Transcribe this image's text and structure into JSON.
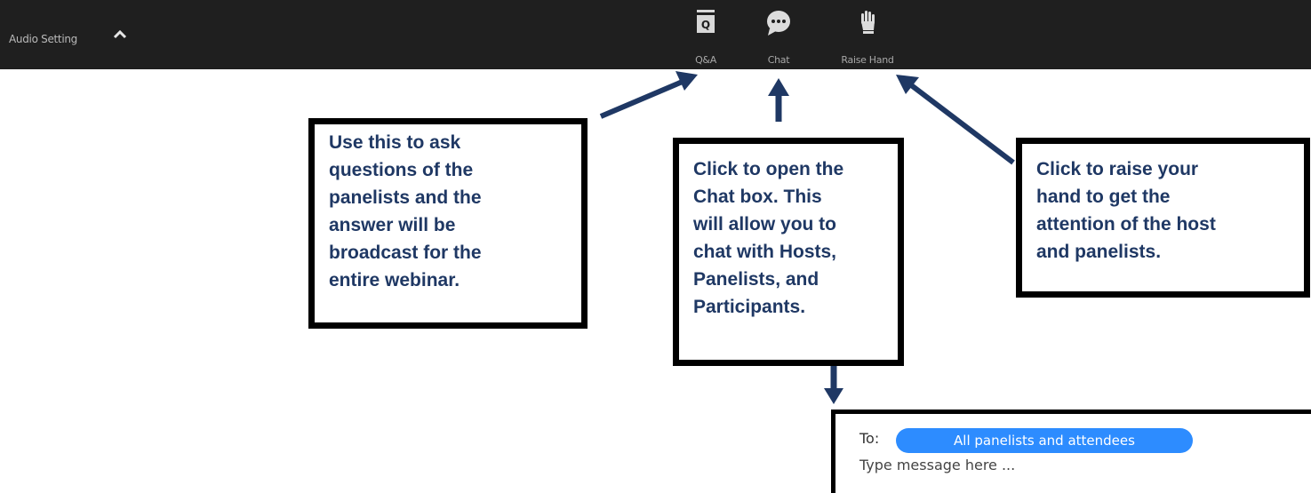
{
  "toolbar": {
    "audio_setting_label": "Audio Setting",
    "buttons": [
      {
        "label": "Q&A",
        "icon": "qa-icon"
      },
      {
        "label": "Chat",
        "icon": "chat-bubble-icon"
      },
      {
        "label": "Raise Hand",
        "icon": "raise-hand-icon"
      }
    ]
  },
  "callouts": {
    "qa": [
      "Use this to ask",
      "questions of the",
      "panelists and the",
      "answer will be",
      "broadcast for the",
      "entire webinar."
    ],
    "chat": [
      "Click to open the",
      "Chat box. This",
      "will allow you to",
      "chat with Hosts,",
      "Panelists, and",
      "Participants."
    ],
    "raise_hand": [
      "Click to raise your",
      "hand to get the",
      "attention of the host",
      "and panelists."
    ]
  },
  "chat_preview": {
    "to_label": "To:",
    "recipient": "All panelists and attendees",
    "placeholder": "Type message here ..."
  },
  "colors": {
    "toolbar_bg": "#1f1f1f",
    "callout_text": "#1f3864",
    "arrow": "#1f3864",
    "pill": "#2d8cff"
  }
}
